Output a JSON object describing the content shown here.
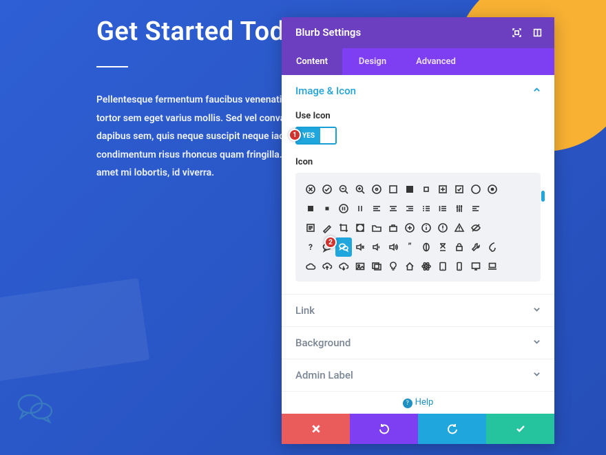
{
  "page": {
    "title": "Get Started Today",
    "body": "Pellentesque fermentum faucibus venenatis. Proin sodales tortor sem eget varius mollis. Sed vel convallis dui. Proin dapibus sem, quis neque suscipit neque iaculis, non condimentum risus rhoncus quam fringilla. Cras blandit urna sit amet mi lobortis, id viverra."
  },
  "modal": {
    "title": "Blurb Settings",
    "tabs": [
      "Content",
      "Design",
      "Advanced"
    ],
    "active_tab": 0,
    "sections": {
      "image_icon": {
        "title": "Image & Icon",
        "open": true
      },
      "link": {
        "title": "Link",
        "open": false
      },
      "background": {
        "title": "Background",
        "open": false
      },
      "admin": {
        "title": "Admin Label",
        "open": false
      }
    },
    "fields": {
      "use_icon_label": "Use Icon",
      "use_icon_value": "YES",
      "icon_label": "Icon"
    },
    "help_label": "Help",
    "callouts": {
      "one": "1",
      "two": "2"
    }
  },
  "icons": {
    "names": [
      "circle-x",
      "circle-check",
      "zoom-out",
      "zoom-in",
      "circle-dot-outline",
      "square-outline",
      "square-solid",
      "square-mini",
      "square-plus",
      "check-square",
      "circle-outline",
      "radio-dot",
      "stop-solid",
      "stop-small",
      "pause-circle",
      "pause-bars",
      "menu-left",
      "menu-center",
      "menu-right",
      "list-bullets",
      "list-numbered",
      "sliders",
      "align-left",
      "note",
      "brush",
      "crop",
      "maximize",
      "folder",
      "briefcase",
      "circle-plus",
      "info-circle",
      "exclamation-circle",
      "warning-triangle",
      "hide-eye",
      "question",
      "chat-bubble",
      "chat-bubbles",
      "volume-mute",
      "volume-low",
      "volume-high",
      "quotes",
      "dollar",
      "hourglass",
      "lock",
      "wrench",
      "paint",
      "cloud",
      "cloud-up",
      "cloud-down",
      "image",
      "gallery",
      "bulb",
      "home",
      "atom",
      "tablet",
      "phone",
      "monitor",
      "laptop"
    ],
    "selected_index": 36
  },
  "colors": {
    "brand_purple": "#7e3ff2",
    "brand_purple_dark": "#6b3fbf",
    "accent_blue": "#1fa6dd",
    "danger": "#ea5b5b",
    "success": "#26c39f",
    "callout_red": "#d2322d"
  }
}
